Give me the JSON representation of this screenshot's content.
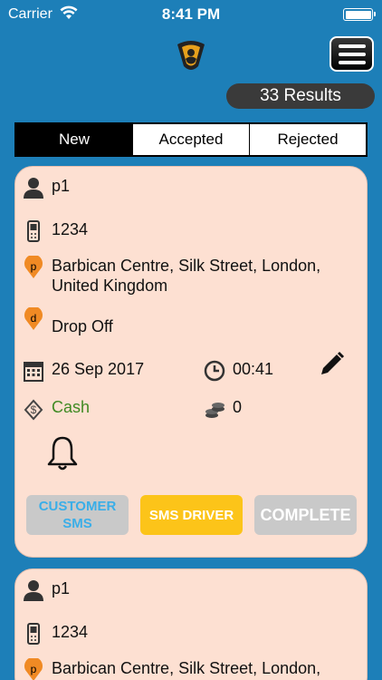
{
  "status_bar": {
    "carrier": "Carrier",
    "time": "8:41 PM"
  },
  "header": {
    "results": "33 Results"
  },
  "tabs": [
    {
      "label": "New",
      "active": true
    },
    {
      "label": "Accepted",
      "active": false
    },
    {
      "label": "Rejected",
      "active": false
    }
  ],
  "cards": [
    {
      "name": "p1",
      "phone": "1234",
      "pickup": "Barbican Centre, Silk Street, London, United Kingdom",
      "dropoff": "Drop Off",
      "date": "26 Sep 2017",
      "time": "00:41",
      "payment": "Cash",
      "payment_color": "#3f8a23",
      "amount": "0",
      "buttons": {
        "customer_sms": "CUSTOMER SMS",
        "sms_driver": "SMS DRIVER",
        "complete": "COMPLETE"
      }
    },
    {
      "name": "p1",
      "phone": "1234",
      "pickup": "Barbican Centre, Silk Street, London, United Kingdom"
    }
  ],
  "icons": {
    "user": "user-icon",
    "phone": "phone-icon",
    "pickup": "pickup-pin-icon",
    "dropoff": "dropoff-pin-icon",
    "calendar": "calendar-icon",
    "clock": "clock-icon",
    "payment": "payment-icon",
    "coins": "coins-icon",
    "bell": "bell-icon",
    "edit": "pencil-icon",
    "menu": "menu-icon",
    "logo": "app-logo-icon"
  }
}
